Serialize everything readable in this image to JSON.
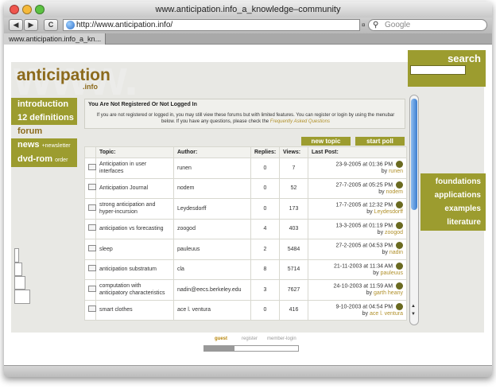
{
  "window": {
    "title": "www.anticipation.info_a_knowledge–community"
  },
  "toolbar": {
    "back": "◀",
    "forward": "▶",
    "reload": "C",
    "url": "http://www.anticipation.info/",
    "search_placeholder": "Google",
    "search_icon": "magnifier-icon",
    "url_menu": "¤"
  },
  "tab": {
    "label": "www.anticipation.info_a_kn..."
  },
  "site": {
    "watermark": "www.",
    "logo": "anticipation",
    "logo_sub": ".info",
    "search_label": "search"
  },
  "left_nav": [
    {
      "label": "introduction"
    },
    {
      "label": "12 definitions"
    },
    {
      "label": "forum"
    },
    {
      "label": "news",
      "sub": "+newsletter"
    },
    {
      "label": "dvd-rom",
      "sub": "order"
    }
  ],
  "right_nav": [
    "foundations",
    "applications",
    "examples",
    "literature"
  ],
  "notice": {
    "title": "You Are Not Registered Or Not Logged In",
    "body": "If you are not registered or logged in, you may still view these forums but with limited features. You can register or login by using the menubar below. If you have any questions, please check the",
    "link": "Frequently Asked Questions"
  },
  "buttons": {
    "new_topic": "new topic",
    "start_poll": "start poll"
  },
  "table": {
    "headers": [
      "Topic:",
      "Author:",
      "Replies:",
      "Views:",
      "Last Post:"
    ],
    "rows": [
      {
        "topic": "Anticipation in user interfaces",
        "author": "runen",
        "replies": "0",
        "views": "7",
        "last": "23-9-2005 at 01:36 PM",
        "by": "runen"
      },
      {
        "topic": "Anticipation Journal",
        "author": "nodem",
        "replies": "0",
        "views": "52",
        "last": "27-7-2005 at 05:25 PM",
        "by": "nodem"
      },
      {
        "topic": "strong anticipation and hyper-incursion",
        "author": "Leydesdorff",
        "replies": "0",
        "views": "173",
        "last": "17-7-2005 at 12:32 PM",
        "by": "Leydesdorff"
      },
      {
        "topic": "anticipation vs forecasting",
        "author": "zoogod",
        "replies": "4",
        "views": "403",
        "last": "13-3-2005 at 01:19 PM",
        "by": "zoogod"
      },
      {
        "topic": "sleep",
        "author": "pauleuus",
        "replies": "2",
        "views": "5484",
        "last": "27-2-2005 at 04:53 PM",
        "by": "nadin"
      },
      {
        "topic": "anticipation substratum",
        "author": "cla",
        "replies": "8",
        "views": "5714",
        "last": "21-11-2003 at 11:34 AM",
        "by": "pauleuus"
      },
      {
        "topic": "computation with anticipatory characteristics",
        "author": "nadin@eecs.berkeley.edu",
        "replies": "3",
        "views": "7627",
        "last": "24-10-2003 at 11:59 AM",
        "by": "garth heany"
      },
      {
        "topic": "smart clothes",
        "author": "ace l. ventura",
        "replies": "0",
        "views": "416",
        "last": "9-10-2003 at 04:54 PM",
        "by": "ace l. ventura"
      }
    ]
  },
  "by_prefix": "by",
  "bottom_tabs": [
    "guest",
    "register",
    "member-login"
  ],
  "colors": {
    "olive": "#9c9c2f",
    "brown": "#8c6a1c"
  }
}
